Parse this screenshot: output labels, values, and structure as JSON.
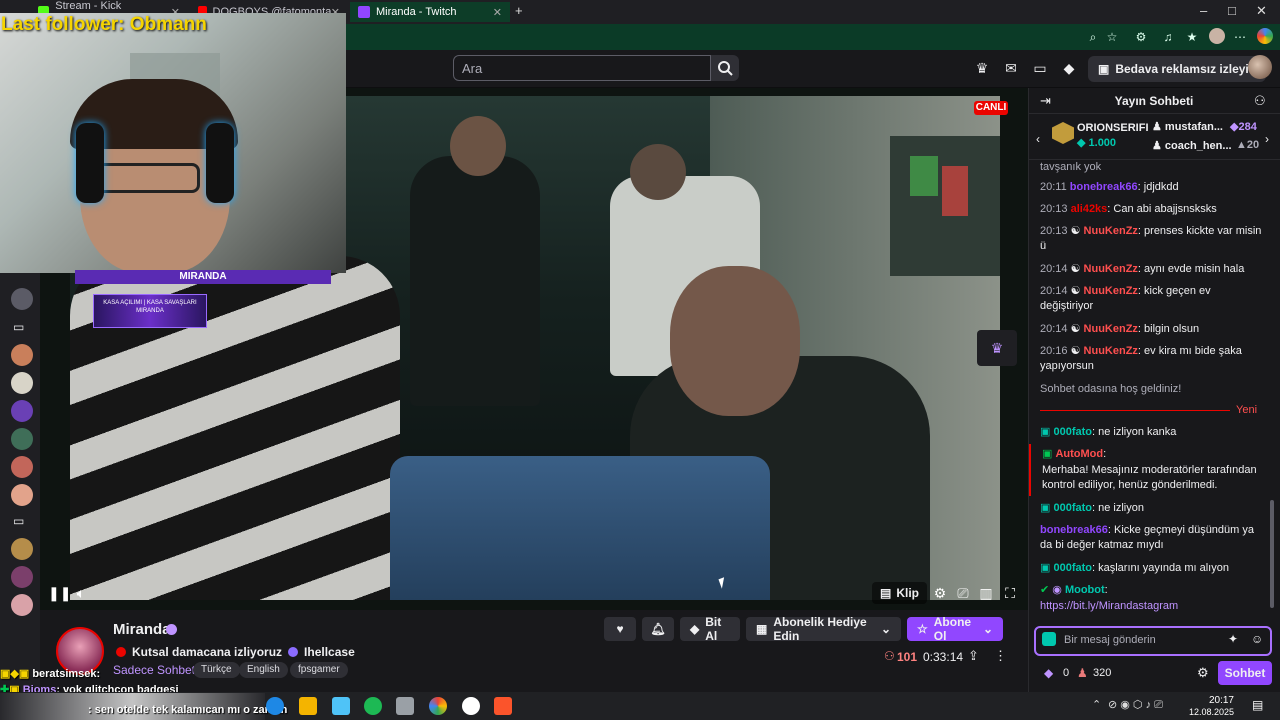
{
  "browser": {
    "tabs": [
      {
        "title": "Stream - Kick Dashboard",
        "color": "#53fc18"
      },
      {
        "title": "DOGBOYS @fatomontaj / @ilkins",
        "color": "#ff0000"
      },
      {
        "title": "Miranda - Twitch",
        "color": "#9146ff"
      }
    ]
  },
  "overlay": {
    "last_follower": "Last follower: Obmann",
    "banner1": "MIRANDA",
    "banner2": "KASA AÇILIMI | KASA SAVAŞLARI MIRANDA"
  },
  "topnav": {
    "search_placeholder": "Ara",
    "turbo_label": "Bedava reklamsız izleyin"
  },
  "video": {
    "live_label": "CANLI",
    "clip_label": "Klip"
  },
  "channel": {
    "name": "Miranda",
    "title_part1": "Kutsal damacana izliyoruz",
    "title_part2": "Ihellcase",
    "category": "Sadece Sohbet",
    "tags": [
      "Türkçe",
      "English",
      "fpsgamer"
    ],
    "bits_label": "Bit Al",
    "gift_label": "Abonelik Hediye Edin",
    "subscribe_label": "Abone Ol",
    "viewers": "101",
    "uptime": "0:33:14"
  },
  "chat": {
    "header": "Yayın Sohbeti",
    "leaderboard": {
      "top_user": "ORIONSERIFI",
      "top_value": "1.000",
      "user2": "mustafan...",
      "user2_value": "284",
      "user3": "coach_hen...",
      "user3_value": "20"
    },
    "cut_text": "tavşanık yok",
    "messages": [
      {
        "ts": "20:11",
        "user": "bonebreak66",
        "color": "#9147ff",
        "text": ": jdjdkdd"
      },
      {
        "ts": "20:13",
        "user": "ali42ks",
        "color": "#eb0400",
        "text": ": Can abi abajjsnsksks"
      },
      {
        "ts": "20:13",
        "user": "NuuKenZz",
        "color": "#ff4f4f",
        "text": ": prenses kickte var misin ü"
      },
      {
        "ts": "20:14",
        "user": "NuuKenZz",
        "color": "#ff4f4f",
        "text": ": aynı evde misin hala"
      },
      {
        "ts": "20:14",
        "user": "NuuKenZz",
        "color": "#ff4f4f",
        "text": ": kick geçen ev değiştiriyor"
      },
      {
        "ts": "20:14",
        "user": "NuuKenZz",
        "color": "#ff4f4f",
        "text": ": bilgin olsun"
      },
      {
        "ts": "20:16",
        "user": "NuuKenZz",
        "color": "#ff4f4f",
        "text": ": ev kira mı bide şaka yapıyorsun"
      }
    ],
    "welcome": "Sohbet odasına hoş geldiniz!",
    "new_label": "Yeni",
    "messages2": [
      {
        "user": "000fato",
        "color": "#00c8af",
        "text": ": ne izliyon kanka"
      },
      {
        "user": "AutoMod",
        "color": "#ff4f4f",
        "text": ":"
      },
      {
        "user": "000fato",
        "color": "#00c8af",
        "text": ": ne izliyon"
      },
      {
        "user": "bonebreak66",
        "color": "#9147ff",
        "text": ": Kicke geçmeyi düşündüm ya da bi değer katmaz mıydı"
      },
      {
        "user": "000fato",
        "color": "#00c8af",
        "text": ": kaşlarını yayında mı alıyon"
      },
      {
        "user": "Moobot",
        "color": "#00c8af",
        "text": ":"
      }
    ],
    "automod_text": "Merhaba! Mesajınız moderatörler tarafından kontrol ediliyor, henüz gönderilmedi.",
    "moobot_link": "https://bit.ly/Mirandastagram",
    "input_placeholder": "Bir mesaj gönderin",
    "points": "0",
    "points2": "320",
    "send_label": "Sohbet"
  },
  "stream_chat_overlay": {
    "line1_user": "beratsimsek",
    "line1_text": ":",
    "line2_user": "Bjoms",
    "line2_text": ": yok glitchcon badgesi",
    "line3_text": ": sen otelde tek kalamıcan mı o zaman"
  },
  "taskbar": {
    "time": "20:17",
    "date": "12.08.2025"
  }
}
